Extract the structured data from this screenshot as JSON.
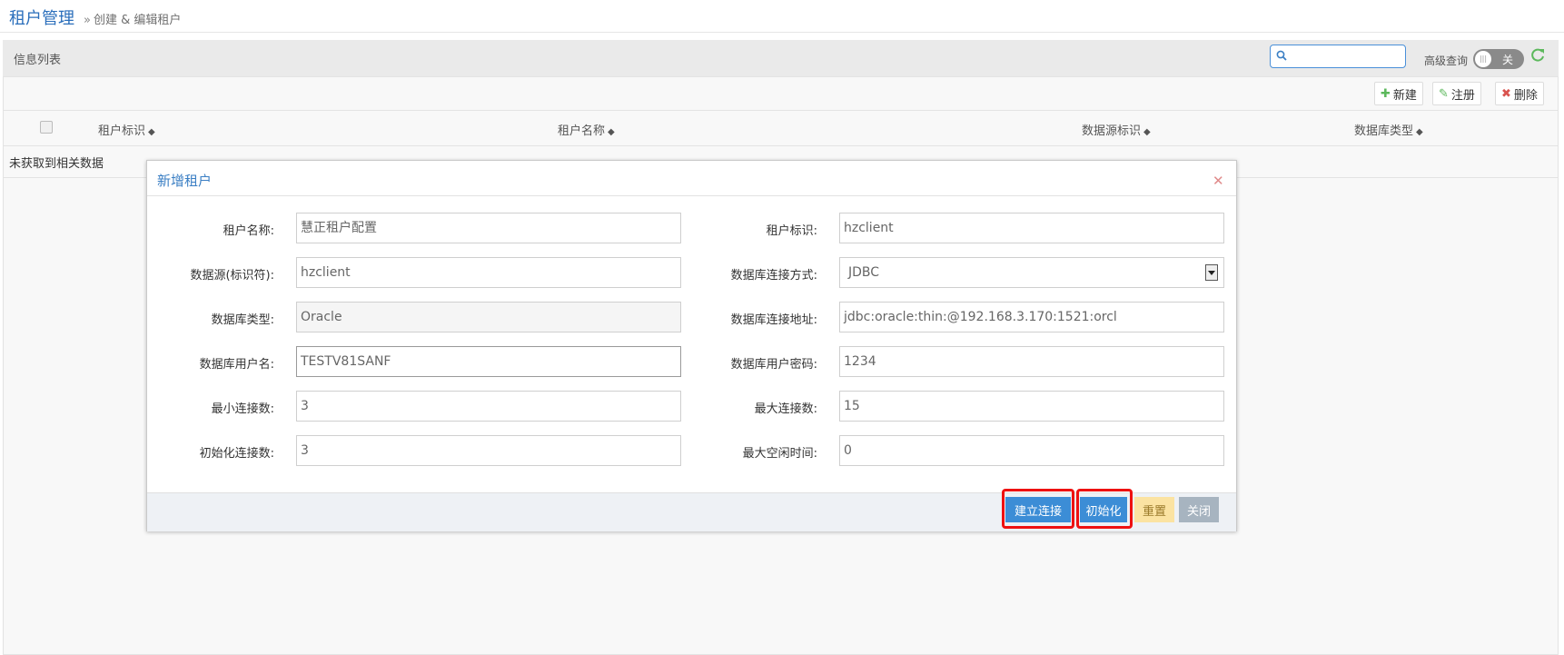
{
  "page": {
    "title": "租户管理",
    "breadcrumb": "创建 & 编辑租户"
  },
  "panel": {
    "title": "信息列表",
    "search_placeholder": "",
    "advanced_label": "高级查询",
    "toggle_state": "关",
    "toolbar": {
      "new_label": "新建",
      "register_label": "注册",
      "delete_label": "删除"
    },
    "columns": [
      "租户标识",
      "租户名称",
      "数据源标识",
      "数据库类型"
    ],
    "empty_text": "未获取到相关数据"
  },
  "modal": {
    "title": "新增租户",
    "fields": [
      {
        "label": "租户名称:",
        "value": "慧正租户配置"
      },
      {
        "label": "租户标识:",
        "value": "hzclient"
      },
      {
        "label": "数据源(标识符):",
        "value": "hzclient"
      },
      {
        "label": "数据库连接方式:",
        "value": "JDBC"
      },
      {
        "label": "数据库类型:",
        "value": "Oracle"
      },
      {
        "label": "数据库连接地址:",
        "value": "jdbc:oracle:thin:@192.168.3.170:1521:orcl"
      },
      {
        "label": "数据库用户名:",
        "value": "TESTV81SANF"
      },
      {
        "label": "数据库用户密码:",
        "value": "1234"
      },
      {
        "label": "最小连接数:",
        "value": "3"
      },
      {
        "label": "最大连接数:",
        "value": "15"
      },
      {
        "label": "初始化连接数:",
        "value": "3"
      },
      {
        "label": "最大空闲时间:",
        "value": "0"
      }
    ],
    "buttons": {
      "connect": "建立连接",
      "init": "初始化",
      "reset": "重置",
      "close": "关闭"
    }
  },
  "colors": {
    "accent": "#3c8dd6",
    "highlight": "#e11111"
  }
}
